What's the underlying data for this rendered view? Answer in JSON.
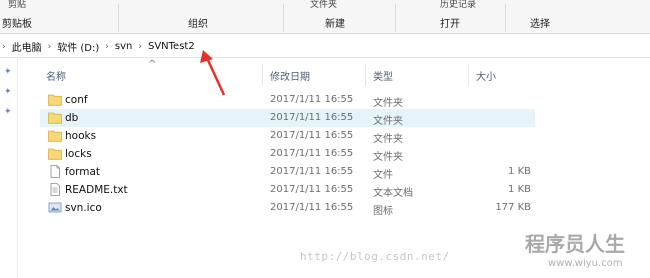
{
  "ribbon": {
    "clipboard_partial": "剪贴",
    "clipboard_group": "剪贴板",
    "organize_group": "组织",
    "new_partial": "文件夹",
    "new_group": "新建",
    "open_partial": "历史记录",
    "open_group": "打开",
    "select_group": "选择"
  },
  "address": {
    "crumbs": [
      "此电脑",
      "软件 (D:)",
      "svn",
      "SVNTest2"
    ]
  },
  "columns": {
    "name": "名称",
    "date": "修改日期",
    "type": "类型",
    "size": "大小"
  },
  "files": [
    {
      "name": "conf",
      "date": "2017/1/11 16:55",
      "type": "文件夹",
      "size": "",
      "icon": "folder-icon"
    },
    {
      "name": "db",
      "date": "2017/1/11 16:55",
      "type": "文件夹",
      "size": "",
      "icon": "folder-icon"
    },
    {
      "name": "hooks",
      "date": "2017/1/11 16:55",
      "type": "文件夹",
      "size": "",
      "icon": "folder-icon"
    },
    {
      "name": "locks",
      "date": "2017/1/11 16:55",
      "type": "文件夹",
      "size": "",
      "icon": "folder-icon"
    },
    {
      "name": "format",
      "date": "2017/1/11 16:55",
      "type": "文件",
      "size": "1 KB",
      "icon": "file-icon"
    },
    {
      "name": "README.txt",
      "date": "2017/1/11 16:55",
      "type": "文本文档",
      "size": "1 KB",
      "icon": "text-file-icon"
    },
    {
      "name": "svn.ico",
      "date": "2017/1/11 16:55",
      "type": "图标",
      "size": "177 KB",
      "icon": "image-file-icon"
    }
  ],
  "selected_row": "db",
  "watermark": {
    "url": "http://blog.csdn.net/",
    "logo": "程序员人生",
    "site": "www.wiyu.com"
  },
  "colors": {
    "selection": "#e5f3fb",
    "folder": "#f8d775",
    "annotation": "#e8302a"
  }
}
